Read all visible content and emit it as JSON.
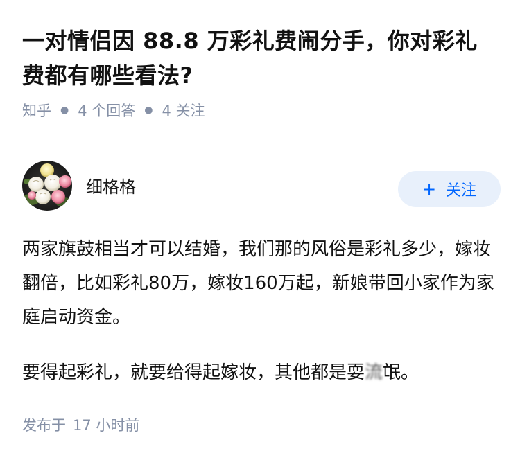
{
  "question": {
    "title": "一对情侣因 88.8 万彩礼费闹分手，你对彩礼费都有哪些看法?",
    "source": "知乎",
    "answer_count": "4 个回答",
    "follower_count": "4 关注"
  },
  "answer": {
    "author_name": "细格格",
    "avatar_icon": "flower-bouquet-avatar",
    "follow_label": "关注",
    "follow_plus": "+",
    "paragraph1": "两家旗鼓相当才可以结婚，我们那的风俗是彩礼多少，嫁妆翻倍，比如彩礼80万，嫁妆160万起，新娘带回小家作为家庭启动资金。",
    "paragraph2_before": "要得起彩礼，就要给得起嫁妆，其他都是耍",
    "paragraph2_blurred": "流",
    "paragraph2_after": "氓。",
    "posted_label": "发布于",
    "posted_time": "17 小时前"
  },
  "colors": {
    "meta_gray": "#8590a6",
    "follow_blue": "#0066ff",
    "follow_bg": "#e8f0fb",
    "divider": "#ebebeb"
  }
}
